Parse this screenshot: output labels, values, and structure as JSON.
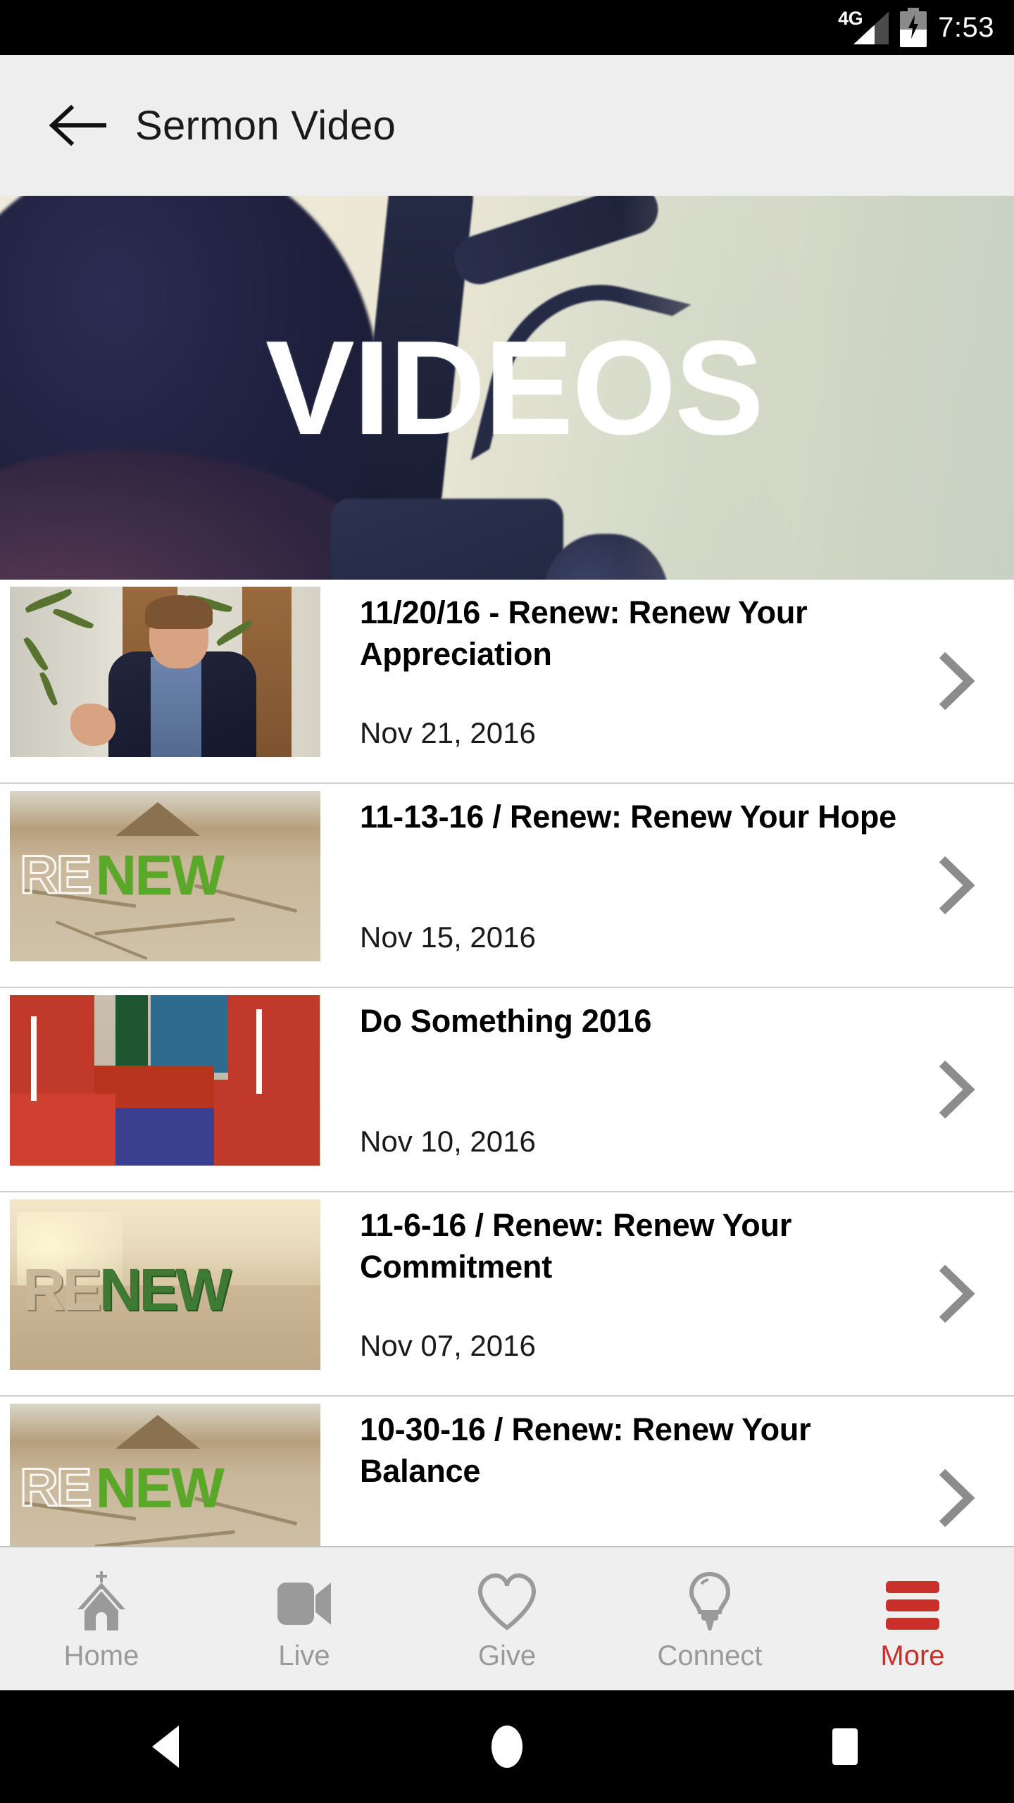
{
  "status_bar": {
    "network_label": "4G",
    "network_icon": "signal-bars-icon",
    "battery_icon": "battery-charging-icon",
    "time": "7:53"
  },
  "header": {
    "back_icon": "arrow-left-icon",
    "title": "Sermon Video"
  },
  "hero": {
    "title": "VIDEOS",
    "image_alt": "video-camera-banner"
  },
  "list": {
    "chevron_icon": "chevron-right-icon",
    "items": [
      {
        "title": "11/20/16 - Renew: Renew Your Appreciation",
        "date": "Nov 21, 2016",
        "thumb": "preacher-speaking-thumbnail"
      },
      {
        "title": "11-13-16 / Renew: Renew Your Hope",
        "date": "Nov 15, 2016",
        "thumb": "renew-cracked-earth-thumbnail",
        "thumb_text_1": "RE",
        "thumb_text_2": "NEW"
      },
      {
        "title": "Do Something 2016",
        "date": "Nov 10, 2016",
        "thumb": "wrapped-gifts-thumbnail"
      },
      {
        "title": "11-6-16 / Renew: Renew Your Commitment",
        "date": "Nov 07, 2016",
        "thumb": "renew-3d-letters-thumbnail",
        "thumb_text_1": "RE",
        "thumb_text_2": "NEW"
      },
      {
        "title": "10-30-16 / Renew: Renew Your Balance",
        "date": "",
        "thumb": "renew-cracked-earth-thumbnail",
        "thumb_text_1": "RE",
        "thumb_text_2": "NEW"
      }
    ]
  },
  "tab_bar": {
    "active_color": "#C9302C",
    "inactive_color": "#9A9A9A",
    "tabs": [
      {
        "label": "Home",
        "icon": "church-icon",
        "active": false
      },
      {
        "label": "Live",
        "icon": "video-camera-icon",
        "active": false
      },
      {
        "label": "Give",
        "icon": "heart-icon",
        "active": false
      },
      {
        "label": "Connect",
        "icon": "lightbulb-icon",
        "active": false
      },
      {
        "label": "More",
        "icon": "hamburger-menu-icon",
        "active": true
      }
    ]
  },
  "android_nav": {
    "back_icon": "triangle-back-icon",
    "home_icon": "circle-home-icon",
    "recents_icon": "square-recents-icon"
  }
}
